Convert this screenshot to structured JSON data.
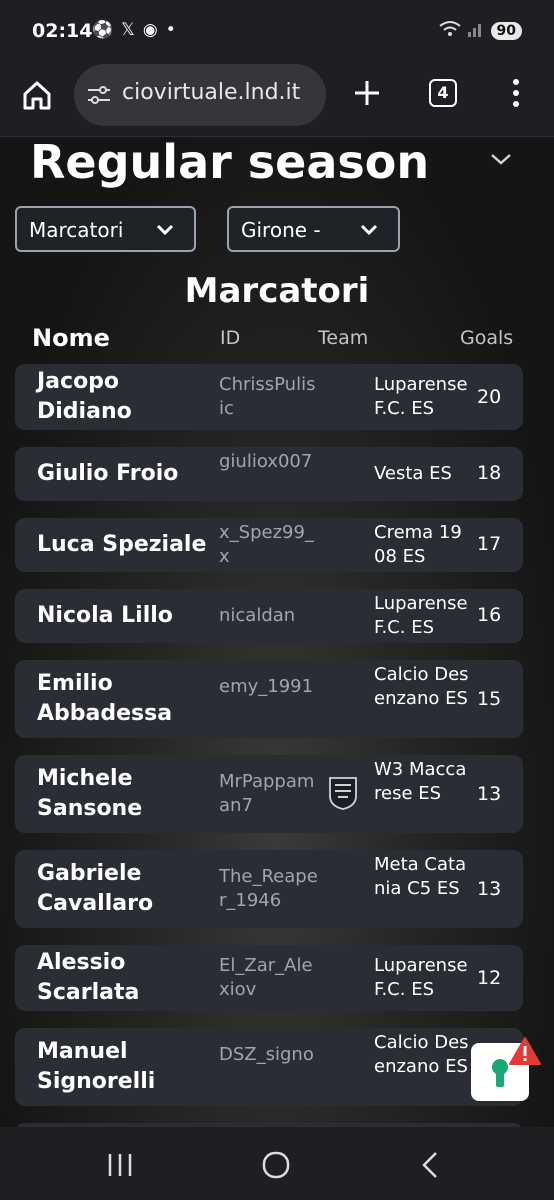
{
  "status": {
    "time": "02:14",
    "battery": "90"
  },
  "browser": {
    "url": "ciovirtuale.lnd.it",
    "tab_count": "4"
  },
  "page": {
    "title": "Regular season",
    "select1": "Marcatori",
    "select2": "Girone  -",
    "section": "Marcatori",
    "headers": {
      "name": "Nome",
      "id": "ID",
      "team": "Team",
      "goals": "Goals"
    }
  },
  "rows": [
    {
      "name": "Jacopo Didiano",
      "id": "ChrissPulisic",
      "team": "Luparense F.C. ES",
      "goals": "20"
    },
    {
      "name": "Giulio Froio",
      "id": "giuliox007",
      "team": "Vesta ES",
      "goals": "18"
    },
    {
      "name": "Luca Speziale",
      "id": "x_Spez99_x",
      "team": "Crema 1908 ES",
      "goals": "17"
    },
    {
      "name": "Nicola Lillo",
      "id": "nicaldan",
      "team": "Luparense F.C. ES",
      "goals": "16"
    },
    {
      "name": "Emilio Abbadessa",
      "id": "emy_1991",
      "team": "Calcio Desenzano ES",
      "goals": "15"
    },
    {
      "name": "Michele Sansone",
      "id": "MrPappaman7",
      "team": "W3 Maccarese ES",
      "goals": "13"
    },
    {
      "name": "Gabriele Cavallaro",
      "id": "The_Reaper_1946",
      "team": "Meta Catania C5 ES",
      "goals": "13"
    },
    {
      "name": "Alessio Scarlata",
      "id": "El_Zar_Alexiov",
      "team": "Luparense F.C. ES",
      "goals": "12"
    },
    {
      "name": "Manuel Signorelli",
      "id": "DSZ_signo",
      "team": "Calcio Desenzano ES",
      "goals": ""
    }
  ]
}
